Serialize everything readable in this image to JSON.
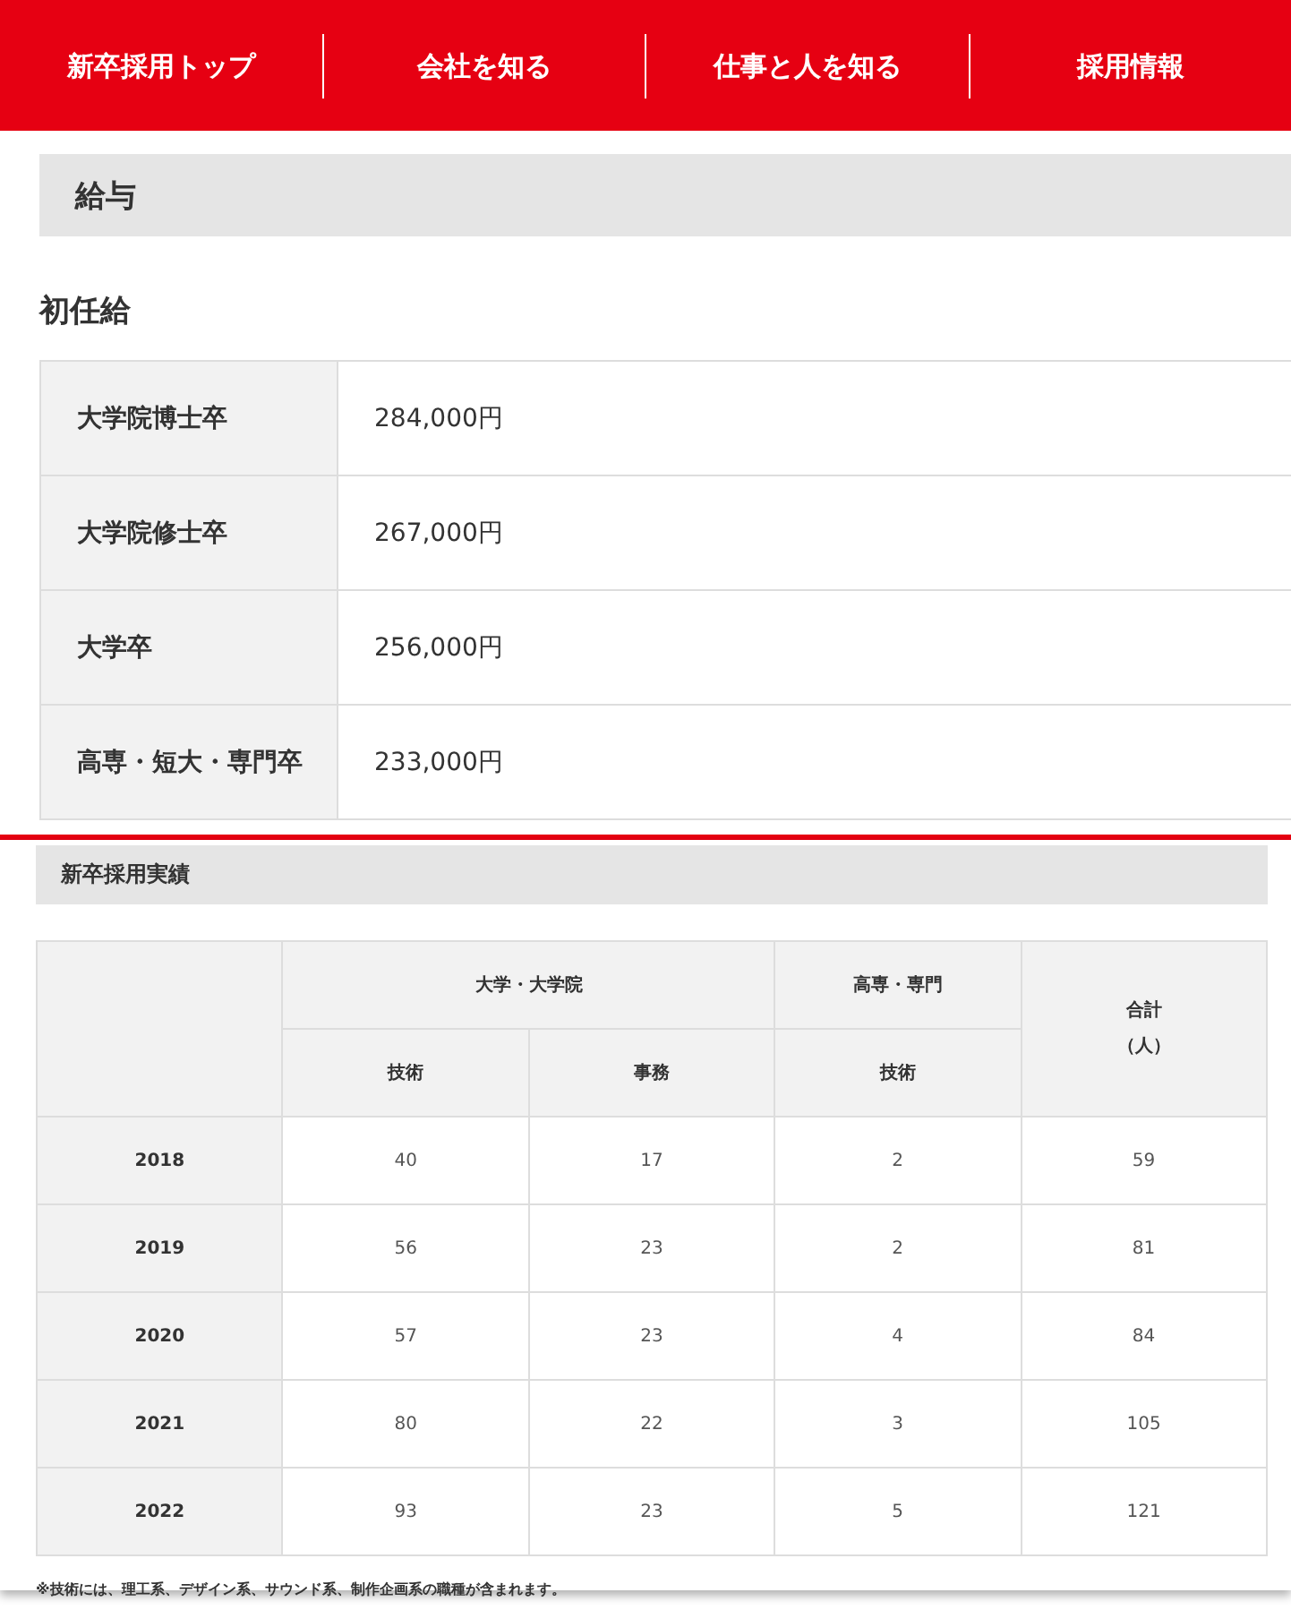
{
  "nav": [
    {
      "label": "新卒採用トップ"
    },
    {
      "label": "会社を知る"
    },
    {
      "label": "仕事と人を知る"
    },
    {
      "label": "採用情報"
    }
  ],
  "salary_section": {
    "title": "給与",
    "subtitle": "初任給",
    "rows": [
      {
        "label": "大学院博士卒",
        "value": "284,000円"
      },
      {
        "label": "大学院修士卒",
        "value": "267,000円"
      },
      {
        "label": "大学卒",
        "value": "256,000円"
      },
      {
        "label": "高専・短大・専門卒",
        "value": "233,000円"
      }
    ]
  },
  "hiring_panel": {
    "title": "新卒採用実績",
    "group_headers": [
      "大学・大学院",
      "高専・専門"
    ],
    "total_header": [
      "合計",
      "（人）"
    ],
    "sub_headers": [
      "技術",
      "事務",
      "技術"
    ],
    "rows": [
      {
        "year": "2018",
        "values": [
          "40",
          "17",
          "2",
          "59"
        ]
      },
      {
        "year": "2019",
        "values": [
          "56",
          "23",
          "2",
          "81"
        ]
      },
      {
        "year": "2020",
        "values": [
          "57",
          "23",
          "4",
          "84"
        ]
      },
      {
        "year": "2021",
        "values": [
          "80",
          "22",
          "3",
          "105"
        ]
      },
      {
        "year": "2022",
        "values": [
          "93",
          "23",
          "5",
          "121"
        ]
      }
    ],
    "note": "※技術には、理工系、デザイン系、サウンド系、制作企画系の職種が含まれます。"
  }
}
